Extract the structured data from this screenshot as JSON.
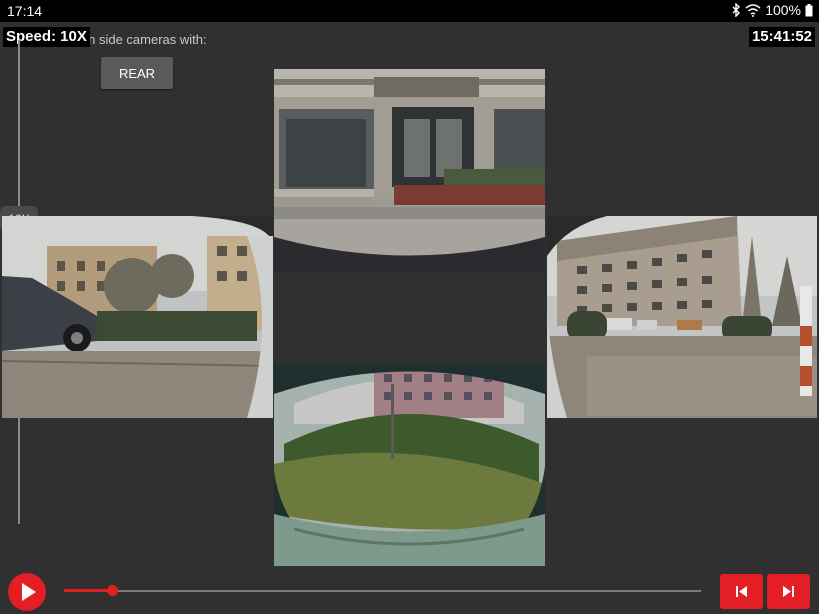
{
  "status_bar": {
    "time": "17:14",
    "battery": "100%",
    "icons": [
      "bluetooth-icon",
      "wifi-icon",
      "battery-icon"
    ]
  },
  "speed_label": "Speed: 10X",
  "align_text": "ign side cameras with:",
  "rear_button": "REAR",
  "clock": "15:41:52",
  "speed_slider": {
    "value_label": "10X"
  },
  "cameras": {
    "front": "front-camera-view",
    "left": "left-camera-view",
    "right": "right-camera-view",
    "rear": "rear-camera-view"
  },
  "playback": {
    "progress_fraction": 0.075,
    "accent_color": "#e31e24"
  }
}
